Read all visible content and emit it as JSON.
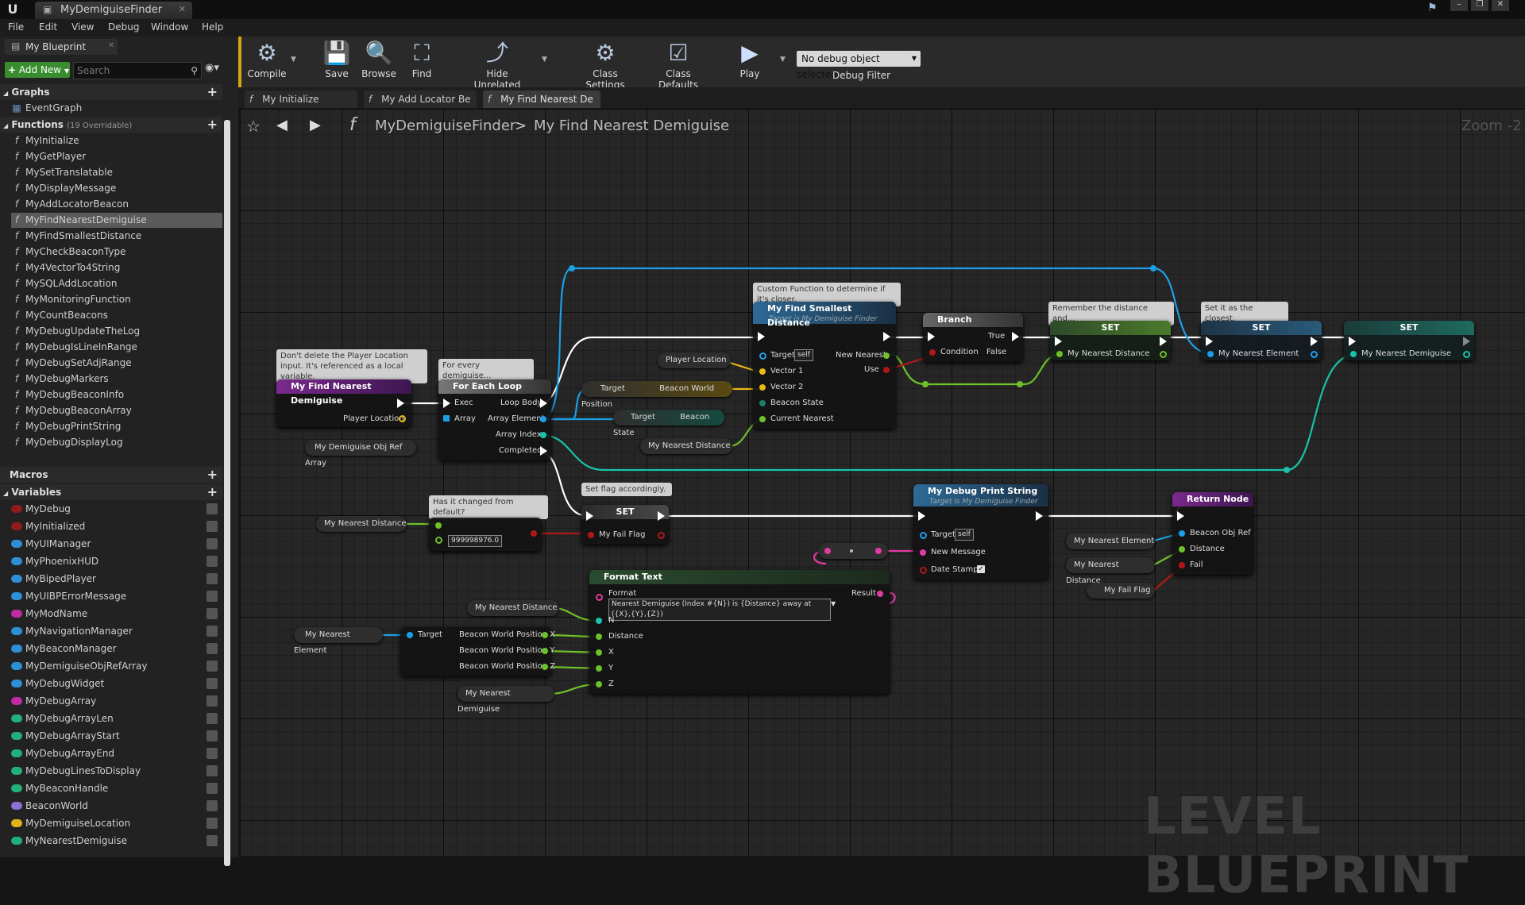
{
  "window": {
    "title": "MyDemiguiseFinder",
    "engine_icon": "unreal-logo"
  },
  "menu": [
    "File",
    "Edit",
    "View",
    "Debug",
    "Window",
    "Help"
  ],
  "my_blueprint": {
    "tab_label": "My Blueprint",
    "add_new_label": "Add New",
    "search_placeholder": "Search",
    "graphs": {
      "label": "Graphs",
      "items": [
        "EventGraph"
      ]
    },
    "functions": {
      "label": "Functions",
      "count": "(19 Overridable)",
      "items": [
        "MyInitialize",
        "MyGetPlayer",
        "MySetTranslatable",
        "MyDisplayMessage",
        "MyAddLocatorBeacon",
        "MyFindNearestDemiguise",
        "MyFindSmallestDistance",
        "MyCheckBeaconType",
        "My4VectorTo4String",
        "MySQLAddLocation",
        "MyMonitoringFunction",
        "MyCountBeacons",
        "MyDebugUpdateTheLog",
        "MyDebugIsLineInRange",
        "MyDebugSetAdjRange",
        "MyDebugMarkers",
        "MyDebugBeaconInfo",
        "MyDebugBeaconArray",
        "MyDebugPrintString",
        "MyDebugDisplayLog"
      ],
      "selected": "MyFindNearestDemiguise"
    },
    "macros": {
      "label": "Macros"
    },
    "variables": {
      "label": "Variables",
      "items": [
        {
          "name": "MyDebug",
          "color": "#8f1b1b"
        },
        {
          "name": "MyInitialized",
          "color": "#8f1b1b"
        },
        {
          "name": "MyUIManager",
          "color": "#2d8fd6"
        },
        {
          "name": "MyPhoenixHUD",
          "color": "#2d8fd6"
        },
        {
          "name": "MyBipedPlayer",
          "color": "#2d8fd6"
        },
        {
          "name": "MyUIBPErrorMessage",
          "color": "#2d8fd6"
        },
        {
          "name": "MyModName",
          "color": "#c02aa3"
        },
        {
          "name": "MyNavigationManager",
          "color": "#2d8fd6"
        },
        {
          "name": "MyBeaconManager",
          "color": "#2d8fd6"
        },
        {
          "name": "MyDemiguiseObjRefArray",
          "color": "#2d8fd6"
        },
        {
          "name": "MyDebugWidget",
          "color": "#2d8fd6"
        },
        {
          "name": "MyDebugArray",
          "color": "#c02aa3"
        },
        {
          "name": "MyDebugArrayLen",
          "color": "#22b07a"
        },
        {
          "name": "MyDebugArrayStart",
          "color": "#22b07a"
        },
        {
          "name": "MyDebugArrayEnd",
          "color": "#22b07a"
        },
        {
          "name": "MyDebugLinesToDisplay",
          "color": "#22b07a"
        },
        {
          "name": "MyBeaconHandle",
          "color": "#22b07a"
        },
        {
          "name": "BeaconWorld",
          "color": "#8a6fd4"
        },
        {
          "name": "MyDemiguiseLocation",
          "color": "#e2b21b"
        },
        {
          "name": "MyNearestDemiguise",
          "color": "#22b07a"
        }
      ]
    }
  },
  "toolbar": {
    "buttons": [
      {
        "label": "Compile",
        "icon": "compile-icon"
      },
      {
        "label": "Save",
        "icon": "save-icon"
      },
      {
        "label": "Browse",
        "icon": "browse-icon"
      },
      {
        "label": "Find",
        "icon": "find-icon"
      },
      {
        "label": "Hide Unrelated",
        "icon": "hide-unrelated-icon"
      },
      {
        "label": "Class Settings",
        "icon": "class-settings-icon"
      },
      {
        "label": "Class Defaults",
        "icon": "class-defaults-icon"
      },
      {
        "label": "Play",
        "icon": "play-icon"
      }
    ],
    "debug_selection": "No debug object selected",
    "debug_filter_label": "Debug Filter"
  },
  "graph_tabs": [
    "My Initialize",
    "My Add Locator Be",
    "My Find Nearest De"
  ],
  "breadcrumb": {
    "blueprint": "MyDemiguiseFinder",
    "function": "My Find Nearest Demiguise",
    "separator": ">"
  },
  "zoom": "Zoom -2",
  "watermark": "LEVEL BLUEPRINT",
  "comments": {
    "c1": "Don't delete the Player Location input. It's referenced as a local variable.",
    "c2": "For every demiguise...",
    "c3": "Custom Function to determine if it's closer.",
    "c4": "Remember the distance and...",
    "c5": "Set it as the closest.",
    "c6": "Has it changed from default?",
    "c7": "Set flag accordingly."
  },
  "nodes": {
    "entry": {
      "title": "My Find Nearest Demiguise",
      "pin_player_location": "Player Location"
    },
    "foreach": {
      "title": "For Each Loop",
      "exec": "Exec",
      "array": "Array",
      "loop_body": "Loop Body",
      "array_element": "Array Element",
      "array_index": "Array Index",
      "completed": "Completed"
    },
    "player_location": "Player Location",
    "beacon_pos": {
      "target": "Target",
      "out": "Beacon World Position"
    },
    "beacon_state": {
      "target": "Target",
      "out": "Beacon State"
    },
    "nearest_dist_var1": "My Nearest Distance",
    "find_smallest": {
      "title": "My Find Smallest Distance",
      "subtitle": "Target is My Demiguise Finder",
      "target": "Target",
      "self": "self",
      "v1": "Vector 1",
      "v2": "Vector 2",
      "state": "Beacon State",
      "current": "Current Nearest",
      "new_nearest": "New Nearest",
      "use": "Use"
    },
    "branch": {
      "title": "Branch",
      "condition": "Condition",
      "true": "True",
      "false": "False"
    },
    "set1": {
      "title": "SET",
      "pin": "My Nearest Distance"
    },
    "set2": {
      "title": "SET",
      "pin": "My Nearest Element"
    },
    "set3": {
      "title": "SET",
      "pin": "My Nearest Demiguise"
    },
    "obj_array_var": "My Demiguise Obj Ref Array",
    "nearest_dist_var2": "My Nearest Distance",
    "compare_literal": "999998976.0",
    "set_flag": {
      "title": "SET",
      "pin": "My Fail Flag"
    },
    "print": {
      "title": "My Debug Print String",
      "subtitle": "Target is My Demiguise Finder",
      "target": "Target",
      "self": "self",
      "message": "New Message",
      "datestamp": "Date Stamp"
    },
    "ret": {
      "title": "Return Node",
      "b": "Beacon Obj Ref",
      "d": "Distance",
      "f": "Fail"
    },
    "ret_vars": [
      "My Nearest Element",
      "My Nearest Distance",
      "My Fail Flag"
    ],
    "format": {
      "title": "Format Text",
      "format_label": "Format",
      "format_value": "Nearest Demiguise (Index #{N}) is {Distance} away at ({X},{Y},{Z})",
      "result": "Result",
      "pins": [
        "N",
        "Distance",
        "X",
        "Y",
        "Z"
      ]
    },
    "fmt_vars": {
      "dist": "My Nearest Distance",
      "elem": "My Nearest Element",
      "demi": "My Nearest Demiguise"
    },
    "break_vec": {
      "target": "Target",
      "x": "Beacon World Position X",
      "y": "Beacon World Position Y",
      "z": "Beacon World Position Z"
    }
  }
}
